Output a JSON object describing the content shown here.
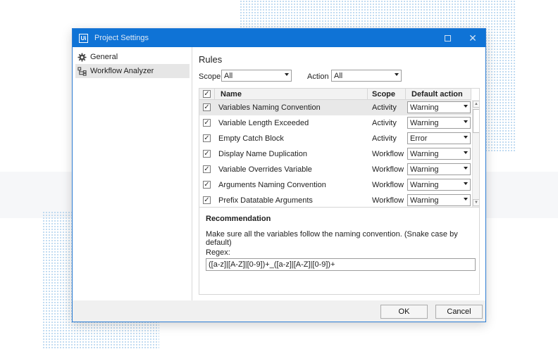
{
  "window": {
    "title": "Project Settings",
    "logo": "Ui"
  },
  "sidebar": {
    "items": [
      {
        "label": "General",
        "icon": "gear-icon"
      },
      {
        "label": "Workflow Analyzer",
        "icon": "workflow-tree-icon"
      }
    ]
  },
  "rules": {
    "title": "Rules",
    "scope_label": "Scope",
    "scope_value": "All",
    "action_label": "Action",
    "action_value": "All",
    "columns": [
      "Name",
      "Scope",
      "Default action"
    ],
    "rows": [
      {
        "checked": true,
        "name": "Variables Naming Convention",
        "scope": "Activity",
        "action": "Warning"
      },
      {
        "checked": true,
        "name": "Variable Length Exceeded",
        "scope": "Activity",
        "action": "Warning"
      },
      {
        "checked": true,
        "name": "Empty Catch Block",
        "scope": "Activity",
        "action": "Error"
      },
      {
        "checked": true,
        "name": "Display Name Duplication",
        "scope": "Workflow",
        "action": "Warning"
      },
      {
        "checked": true,
        "name": "Variable Overrides Variable",
        "scope": "Workflow",
        "action": "Warning"
      },
      {
        "checked": true,
        "name": "Arguments Naming Convention",
        "scope": "Workflow",
        "action": "Warning"
      },
      {
        "checked": true,
        "name": "Prefix Datatable Arguments",
        "scope": "Workflow",
        "action": "Warning"
      }
    ]
  },
  "recommendation": {
    "title": "Recommendation",
    "text": "Make sure all the variables follow the naming convention. (Snake case by default)",
    "regex_label": "Regex:",
    "regex_value": "([a-z]|[A-Z]|[0-9])+_([a-z]|[A-Z]|[0-9])+"
  },
  "buttons": {
    "ok": "OK",
    "cancel": "Cancel"
  },
  "colors": {
    "titlebar": "#0f73d6",
    "selection": "#e8e8e8"
  }
}
